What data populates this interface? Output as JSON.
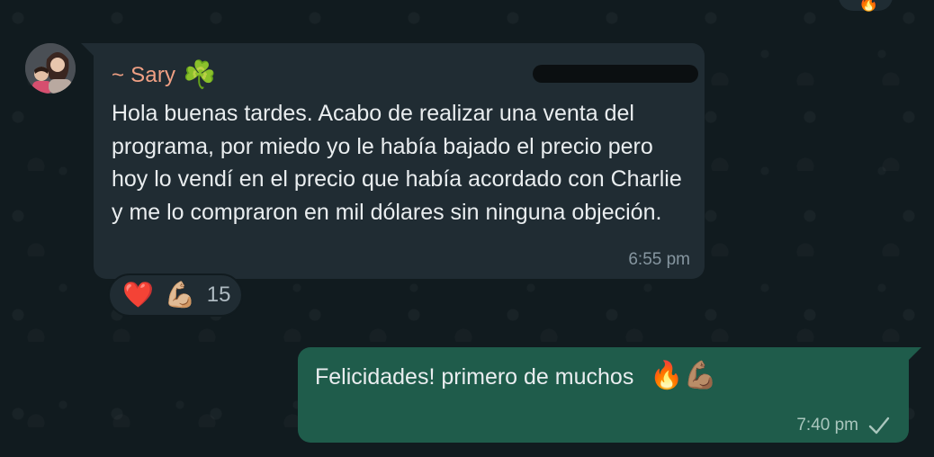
{
  "chat": {
    "incoming": {
      "sender_name": "~ Sary",
      "sender_emoji": "☘️",
      "avatar_icon": "profile-photo",
      "text": "Hola buenas tardes. Acabo de realizar una venta del programa, por miedo yo le había bajado el precio pero hoy lo vendí en el precio que había acordado con Charlie y me lo compraron en mil dólares sin ninguna objeción.",
      "time": "6:55 pm",
      "reactions": {
        "heart": "❤️",
        "muscle": "💪🏼",
        "count": "15"
      }
    },
    "outgoing": {
      "text": "Felicidades! primero de muchos",
      "emoji": "🔥💪🏽",
      "time": "7:40 pm",
      "status_icon": "check-icon"
    },
    "top_partial_reaction": "🔥"
  },
  "colors": {
    "background": "#111b1f",
    "incoming_bubble": "#202c33",
    "outgoing_bubble": "#1f5c4b",
    "sender_name": "#f0a084",
    "timestamp": "#8696a0"
  }
}
